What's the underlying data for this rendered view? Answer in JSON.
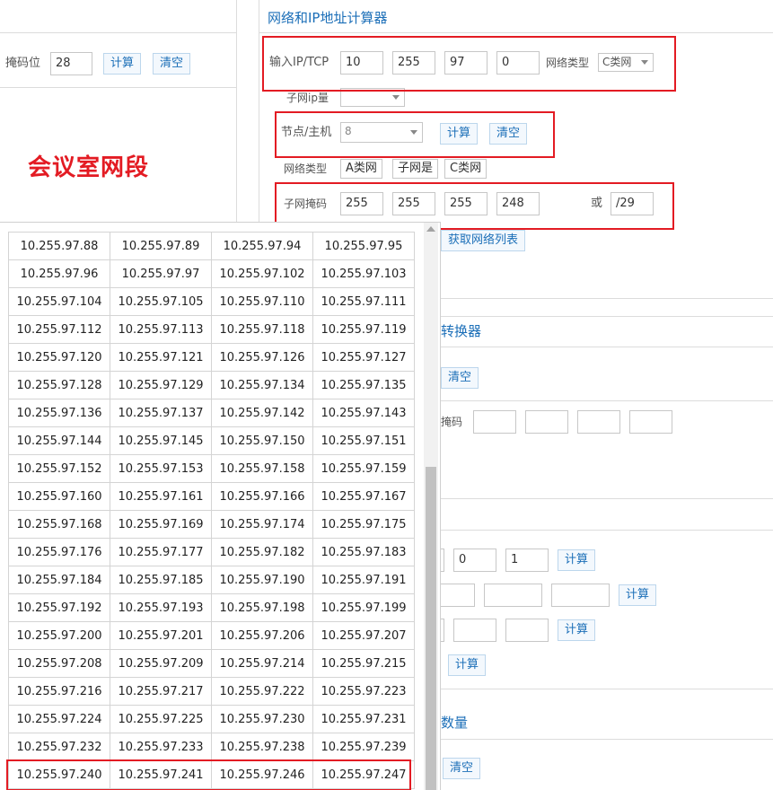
{
  "left_panel": {
    "mask_bits_label": "掩码位",
    "mask_bits_value": "28",
    "calc_label": "计算",
    "clear_label": "清空"
  },
  "annotation": "会议室网段",
  "calculator": {
    "title": "网络和IP地址计算器",
    "ip_label": "输入IP/TCP",
    "ip": [
      "10",
      "255",
      "97",
      "0"
    ],
    "net_type_label": "网络类型",
    "net_type_value": "C类网",
    "subnet_ip_count_label": "子网ip量",
    "node_host_label": "节点/主机",
    "node_host_value": "8",
    "calc_label": "计算",
    "clear_label": "清空",
    "net_type2_label": "网络类型",
    "class_a": "A类网",
    "subnet_is": "子网是",
    "class_c": "C类网",
    "subnet_mask_label": "子网掩码",
    "mask": [
      "255",
      "255",
      "255",
      "248"
    ],
    "or_label": "或",
    "cidr": "/29",
    "get_list_label": "获取网络列表"
  },
  "converter": {
    "title_partial": "转换器",
    "clear_label": "清空",
    "mask_label": "掩码"
  },
  "section3": {
    "field_a": "0",
    "field_b": "1",
    "calc_label": "计算"
  },
  "section4": {
    "title_partial": "数量",
    "clear_label": "清空"
  },
  "ip_table": [
    [
      "10.255.97.88",
      "10.255.97.89",
      "10.255.97.94",
      "10.255.97.95"
    ],
    [
      "10.255.97.96",
      "10.255.97.97",
      "10.255.97.102",
      "10.255.97.103"
    ],
    [
      "10.255.97.104",
      "10.255.97.105",
      "10.255.97.110",
      "10.255.97.111"
    ],
    [
      "10.255.97.112",
      "10.255.97.113",
      "10.255.97.118",
      "10.255.97.119"
    ],
    [
      "10.255.97.120",
      "10.255.97.121",
      "10.255.97.126",
      "10.255.97.127"
    ],
    [
      "10.255.97.128",
      "10.255.97.129",
      "10.255.97.134",
      "10.255.97.135"
    ],
    [
      "10.255.97.136",
      "10.255.97.137",
      "10.255.97.142",
      "10.255.97.143"
    ],
    [
      "10.255.97.144",
      "10.255.97.145",
      "10.255.97.150",
      "10.255.97.151"
    ],
    [
      "10.255.97.152",
      "10.255.97.153",
      "10.255.97.158",
      "10.255.97.159"
    ],
    [
      "10.255.97.160",
      "10.255.97.161",
      "10.255.97.166",
      "10.255.97.167"
    ],
    [
      "10.255.97.168",
      "10.255.97.169",
      "10.255.97.174",
      "10.255.97.175"
    ],
    [
      "10.255.97.176",
      "10.255.97.177",
      "10.255.97.182",
      "10.255.97.183"
    ],
    [
      "10.255.97.184",
      "10.255.97.185",
      "10.255.97.190",
      "10.255.97.191"
    ],
    [
      "10.255.97.192",
      "10.255.97.193",
      "10.255.97.198",
      "10.255.97.199"
    ],
    [
      "10.255.97.200",
      "10.255.97.201",
      "10.255.97.206",
      "10.255.97.207"
    ],
    [
      "10.255.97.208",
      "10.255.97.209",
      "10.255.97.214",
      "10.255.97.215"
    ],
    [
      "10.255.97.216",
      "10.255.97.217",
      "10.255.97.222",
      "10.255.97.223"
    ],
    [
      "10.255.97.224",
      "10.255.97.225",
      "10.255.97.230",
      "10.255.97.231"
    ],
    [
      "10.255.97.232",
      "10.255.97.233",
      "10.255.97.238",
      "10.255.97.239"
    ],
    [
      "10.255.97.240",
      "10.255.97.241",
      "10.255.97.246",
      "10.255.97.247"
    ]
  ],
  "colors": {
    "accent": "#1c6fb8",
    "highlight": "#e31b23"
  }
}
